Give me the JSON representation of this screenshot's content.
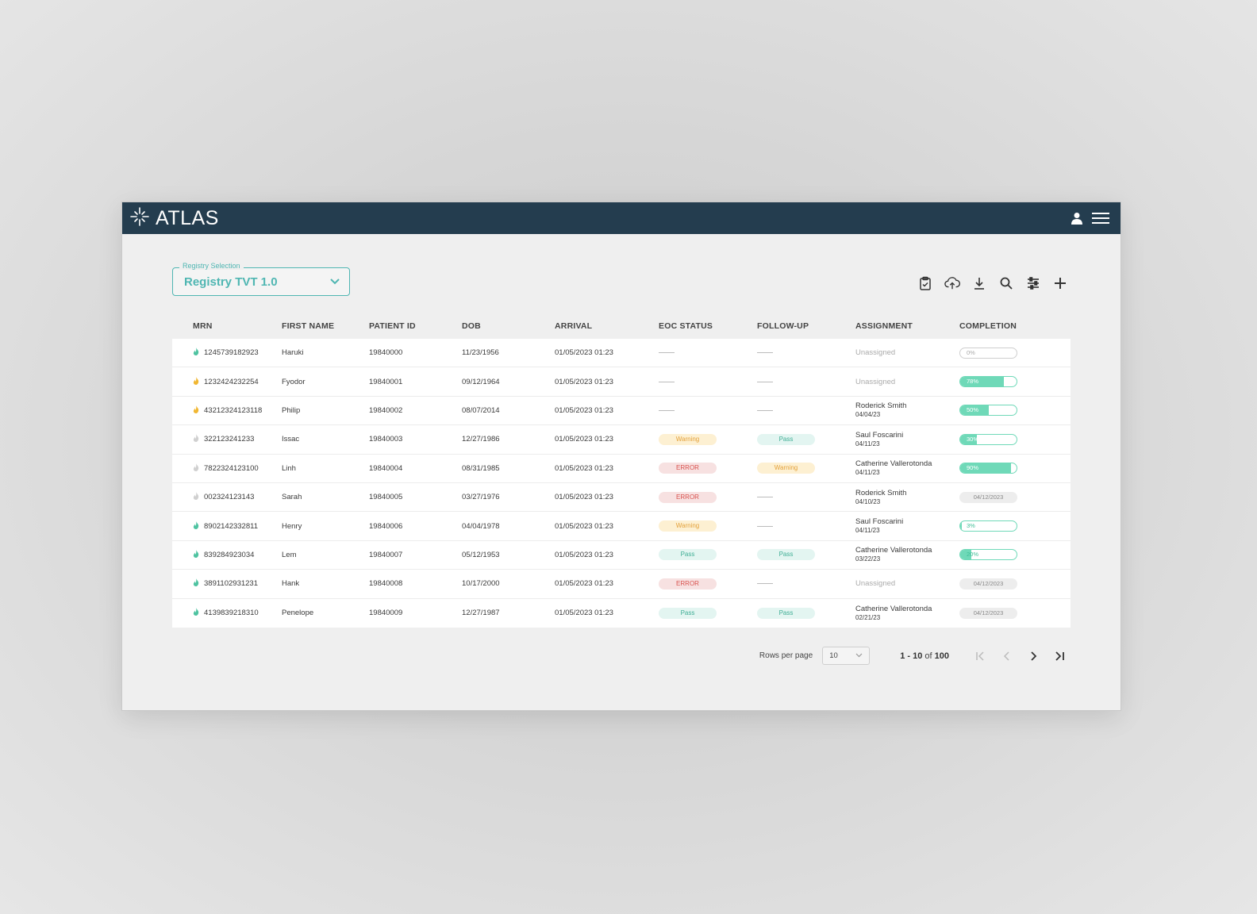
{
  "app": {
    "name": "ATLAS"
  },
  "registry": {
    "label": "Registry Selection",
    "value": "Registry TVT 1.0"
  },
  "toolbar": [
    "clipboard-check-icon",
    "cloud-upload-icon",
    "download-icon",
    "search-icon",
    "sliders-icon",
    "plus-icon"
  ],
  "table": {
    "headers": [
      "MRN",
      "FIRST NAME",
      "PATIENT ID",
      "DOB",
      "ARRIVAL",
      "EOC STATUS",
      "FOLLOW-UP",
      "ASSIGNMENT",
      "COMPLETION"
    ],
    "rows": [
      {
        "mrn": "1245739182923",
        "flag": "green",
        "first": "Haruki",
        "pid": "19840000",
        "dob": "11/23/1956",
        "arrival": "01/05/2023 01:23",
        "eoc": null,
        "fu": null,
        "assignee": null,
        "assign_date": null,
        "unassigned": "Unassigned",
        "completion": 0,
        "completion_label": "0%",
        "completion_date": null
      },
      {
        "mrn": "1232424232254",
        "flag": "yellow",
        "first": "Fyodor",
        "pid": "19840001",
        "dob": "09/12/1964",
        "arrival": "01/05/2023 01:23",
        "eoc": null,
        "fu": null,
        "assignee": null,
        "assign_date": null,
        "unassigned": "Unassigned",
        "completion": 78,
        "completion_label": "78%",
        "completion_date": null
      },
      {
        "mrn": "43212324123118",
        "flag": "yellow",
        "first": "Philip",
        "pid": "19840002",
        "dob": "08/07/2014",
        "arrival": "01/05/2023 01:23",
        "eoc": null,
        "fu": null,
        "assignee": "Roderick Smith",
        "assign_date": "04/04/23",
        "unassigned": null,
        "completion": 50,
        "completion_label": "50%",
        "completion_date": null
      },
      {
        "mrn": "322123241233",
        "flag": "grey",
        "first": "Issac",
        "pid": "19840003",
        "dob": "12/27/1986",
        "arrival": "01/05/2023 01:23",
        "eoc": "Warning",
        "fu": "Pass",
        "assignee": "Saul Foscarini",
        "assign_date": "04/11/23",
        "unassigned": null,
        "completion": 30,
        "completion_label": "30%",
        "completion_date": null
      },
      {
        "mrn": "7822324123100",
        "flag": "grey",
        "first": "Linh",
        "pid": "19840004",
        "dob": "08/31/1985",
        "arrival": "01/05/2023 01:23",
        "eoc": "ERROR",
        "fu": "Warning",
        "assignee": "Catherine Vallerotonda",
        "assign_date": "04/11/23",
        "unassigned": null,
        "completion": 90,
        "completion_label": "90%",
        "completion_date": null
      },
      {
        "mrn": "002324123143",
        "flag": "grey",
        "first": "Sarah",
        "pid": "19840005",
        "dob": "03/27/1976",
        "arrival": "01/05/2023 01:23",
        "eoc": "ERROR",
        "fu": null,
        "assignee": "Roderick Smith",
        "assign_date": "04/10/23",
        "unassigned": null,
        "completion": null,
        "completion_label": null,
        "completion_date": "04/12/2023"
      },
      {
        "mrn": "8902142332811",
        "flag": "green",
        "first": "Henry",
        "pid": "19840006",
        "dob": "04/04/1978",
        "arrival": "01/05/2023 01:23",
        "eoc": "Warning",
        "fu": null,
        "assignee": "Saul Foscarini",
        "assign_date": "04/11/23",
        "unassigned": null,
        "completion": 3,
        "completion_label": "3%",
        "completion_date": null
      },
      {
        "mrn": "839284923034",
        "flag": "green",
        "first": "Lem",
        "pid": "19840007",
        "dob": "05/12/1953",
        "arrival": "01/05/2023 01:23",
        "eoc": "Pass",
        "fu": "Pass",
        "assignee": "Catherine Vallerotonda",
        "assign_date": "03/22/23",
        "unassigned": null,
        "completion": 20,
        "completion_label": "20%",
        "completion_date": null
      },
      {
        "mrn": "3891102931231",
        "flag": "green",
        "first": "Hank",
        "pid": "19840008",
        "dob": "10/17/2000",
        "arrival": "01/05/2023 01:23",
        "eoc": "ERROR",
        "fu": null,
        "assignee": null,
        "assign_date": null,
        "unassigned": "Unassigned",
        "completion": null,
        "completion_label": null,
        "completion_date": "04/12/2023"
      },
      {
        "mrn": "4139839218310",
        "flag": "green",
        "first": "Penelope",
        "pid": "19840009",
        "dob": "12/27/1987",
        "arrival": "01/05/2023 01:23",
        "eoc": "Pass",
        "fu": "Pass",
        "assignee": "Catherine Vallerotonda",
        "assign_date": "02/21/23",
        "unassigned": null,
        "completion": null,
        "completion_label": null,
        "completion_date": "04/12/2023"
      }
    ]
  },
  "status_colors": {
    "Warning": {
      "bg": "#fdf0d2",
      "fg": "#e3a13b"
    },
    "ERROR": {
      "bg": "#f7e1e1",
      "fg": "#d9534f"
    },
    "Pass": {
      "bg": "#e3f5f1",
      "fg": "#3fae95"
    }
  },
  "flag_colors": {
    "green": "#4fc3a1",
    "yellow": "#f1b732",
    "grey": "#d0d0d0"
  },
  "pagination": {
    "rows_label": "Rows per page",
    "rows_value": "10",
    "range": "1 - 10",
    "of_word": "of",
    "total": "100"
  }
}
